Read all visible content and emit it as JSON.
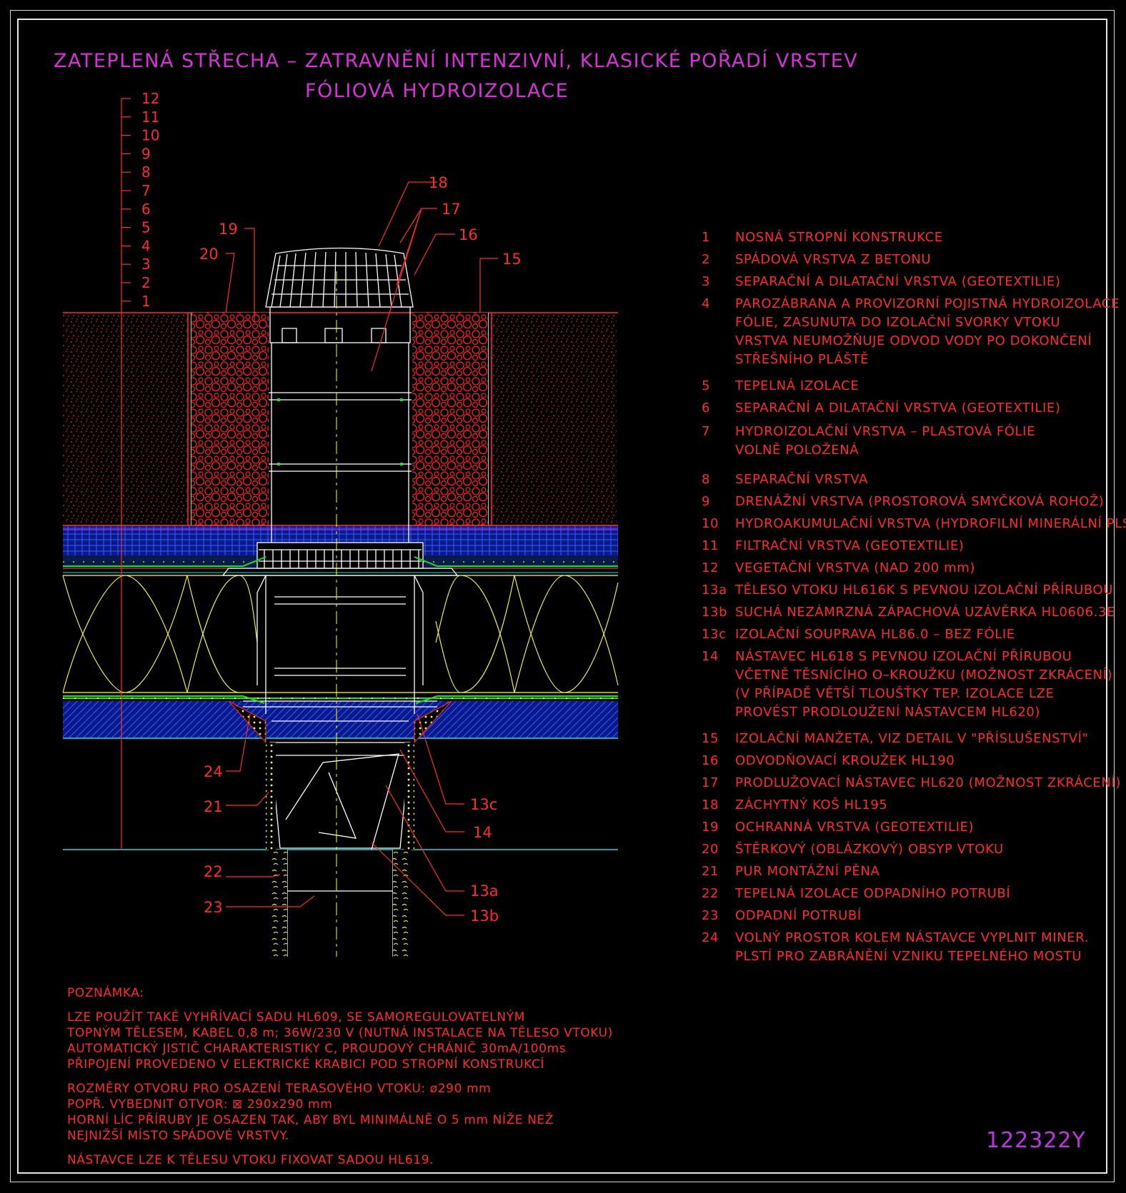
{
  "title_line1": "ZATEPLENÁ STŘECHA – ZATRAVNĚNÍ INTENZIVNÍ, KLASICKÉ POŘADÍ VRSTEV",
  "title_line2": "FÓLIOVÁ HYDROIZOLACE",
  "drawing_code": "122322Y",
  "colors": {
    "background": "#000000",
    "title": "#d633d6",
    "text": "#ff2a2a",
    "substrate": "#ff2a2a",
    "gravel": "#ff2020",
    "drainage": "#1a3bff",
    "insulation": "#ffff33",
    "foil": "#22dd22",
    "cyan_line": "#22d8d8",
    "drain_body": "#ffffff"
  },
  "scale_labels": [
    "12",
    "11",
    "10",
    "9",
    "8",
    "7",
    "6",
    "5",
    "4",
    "3",
    "2",
    "1"
  ],
  "callouts": {
    "c18": "18",
    "c17": "17",
    "c16": "16",
    "c15": "15",
    "c19": "19",
    "c20": "20",
    "c24": "24",
    "c21": "21",
    "c22": "22",
    "c23": "23",
    "c13c": "13c",
    "c14": "14",
    "c13a": "13a",
    "c13b": "13b"
  },
  "legend": [
    {
      "num": "1",
      "lines": [
        "NOSNÁ STROPNÍ KONSTRUKCE"
      ]
    },
    {
      "num": "2",
      "lines": [
        "SPÁDOVÁ VRSTVA Z BETONU"
      ]
    },
    {
      "num": "3",
      "lines": [
        "SEPARAČNÍ A DILATAČNÍ VRSTVA (GEOTEXTILIE)"
      ]
    },
    {
      "num": "4",
      "lines": [
        "PAROZÁBRANA A PROVIZORNÍ POJISTNÁ HYDROIZOLACE",
        "FÓLIE, ZASUNUTA DO IZOLAČNÍ SVORKY VTOKU",
        "VRSTVA NEUMOŽŇUJE ODVOD VODY PO DOKONČENÍ",
        "STŘEŠNÍHO PLÁŠTĚ"
      ]
    },
    {
      "num": "5",
      "lines": [
        "TEPELNÁ IZOLACE"
      ]
    },
    {
      "num": "6",
      "lines": [
        "SEPARAČNÍ A DILATAČNÍ VRSTVA (GEOTEXTILIE)"
      ]
    },
    {
      "num": "7",
      "lines": [
        "HYDROIZOLAČNÍ VRSTVA – PLASTOVÁ FÓLIE",
        "VOLNĚ POLOŽENÁ"
      ]
    },
    {
      "num": "8",
      "lines": [
        "SEPARAČNÍ VRSTVA"
      ]
    },
    {
      "num": "9",
      "lines": [
        "DRENÁŽNÍ VRSTVA (PROSTOROVÁ SMYČKOVÁ ROHOŽ)"
      ]
    },
    {
      "num": "10",
      "lines": [
        "HYDROAKUMULAČNÍ VRSTVA (HYDROFILNÍ MINERÁLNÍ PLST)"
      ]
    },
    {
      "num": "11",
      "lines": [
        "FILTRAČNÍ VRSTVA (GEOTEXTILIE)"
      ]
    },
    {
      "num": "12",
      "lines": [
        "VEGETAČNÍ VRSTVA (NAD 200 mm)"
      ]
    },
    {
      "num": "13a",
      "lines": [
        "TĚLESO VTOKU HL616K S PEVNOU IZOLAČNÍ PŘÍRUBOU"
      ]
    },
    {
      "num": "13b",
      "lines": [
        "SUCHÁ NEZÁMRZNÁ ZÁPACHOVÁ UZÁVĚRKA HL0606.3E"
      ]
    },
    {
      "num": "13c",
      "lines": [
        "IZOLAČNÍ SOUPRAVA HL86.0 – BEZ FÓLIE"
      ]
    },
    {
      "num": "14",
      "lines": [
        "NÁSTAVEC HL618 S PEVNOU IZOLAČNÍ PŘÍRUBOU",
        "VČETNĚ TĚSNÍCÍHO O–KROUŽKU (MOŽNOST ZKRÁCENÍ)",
        "(V PŘÍPADĚ VĚTŠÍ TLOUŠŤKY TEP. IZOLACE LZE",
        "PROVÉST PRODLOUŽENÍ NÁSTAVCEM HL620)"
      ]
    },
    {
      "num": "15",
      "lines": [
        "IZOLAČNÍ MANŽETA, VIZ DETAIL V \"PŘÍSLUŠENSTVÍ\""
      ]
    },
    {
      "num": "16",
      "lines": [
        "ODVODŇOVACÍ KROUŽEK HL190"
      ]
    },
    {
      "num": "17",
      "lines": [
        "PRODLUŽOVACÍ NÁSTAVEC HL620 (MOŽNOST ZKRÁCENÍ)"
      ]
    },
    {
      "num": "18",
      "lines": [
        "ZÁCHYTNÝ KOŠ HL195"
      ]
    },
    {
      "num": "19",
      "lines": [
        "OCHRANNÁ VRSTVA (GEOTEXTILIE)"
      ]
    },
    {
      "num": "20",
      "lines": [
        "ŠTĚRKOVÝ (OBLÁZKOVÝ) OBSYP VTOKU"
      ]
    },
    {
      "num": "21",
      "lines": [
        "PUR MONTÁŽNÍ PĚNA"
      ]
    },
    {
      "num": "22",
      "lines": [
        "TEPELNÁ IZOLACE ODPADNÍHO POTRUBÍ"
      ]
    },
    {
      "num": "23",
      "lines": [
        "ODPADNÍ POTRUBÍ"
      ]
    },
    {
      "num": "24",
      "lines": [
        "VOLNÝ PROSTOR KOLEM NÁSTAVCE VYPLNIT MINER.",
        "PLSTÍ PRO ZABRÁNĚNÍ VZNIKU TEPELNÉHO MOSTU"
      ]
    }
  ],
  "note": {
    "heading": "POZNÁMKA:",
    "para1": [
      "LZE POUŽÍT TAKÉ VYHŘÍVACÍ SADU HL609, SE SAMOREGULOVATELNÝM",
      "TOPNÝM TĚLESEM, KABEL 0,8 m; 36W/230 V (NUTNÁ INSTALACE NA TĚLESO VTOKU)",
      "AUTOMATICKÝ JISTIČ CHARAKTERISTIKY C, PROUDOVÝ CHRÁNIČ 30mA/100ms",
      "PŘIPOJENÍ PROVEDENO V ELEKTRICKÉ KRABICI POD STROPNÍ KONSTRUKCÍ"
    ],
    "para2": [
      "ROZMĚRY OTVORU PRO OSAZENÍ TERASOVÉHO VTOKU: ø290 mm",
      "POPŘ. VYBEDNIT OTVOR: ⊠ 290x290 mm",
      "HORNÍ LÍC PŘÍRUBY JE OSAZEN TAK, ABY BYL MINIMÁLNĚ O 5 mm NÍŽE NEŽ",
      "NEJNIŽŠÍ MÍSTO SPÁDOVÉ VRSTVY."
    ],
    "para3": [
      "NÁSTAVCE LZE K TĚLESU VTOKU FIXOVAT SADOU HL619."
    ]
  }
}
